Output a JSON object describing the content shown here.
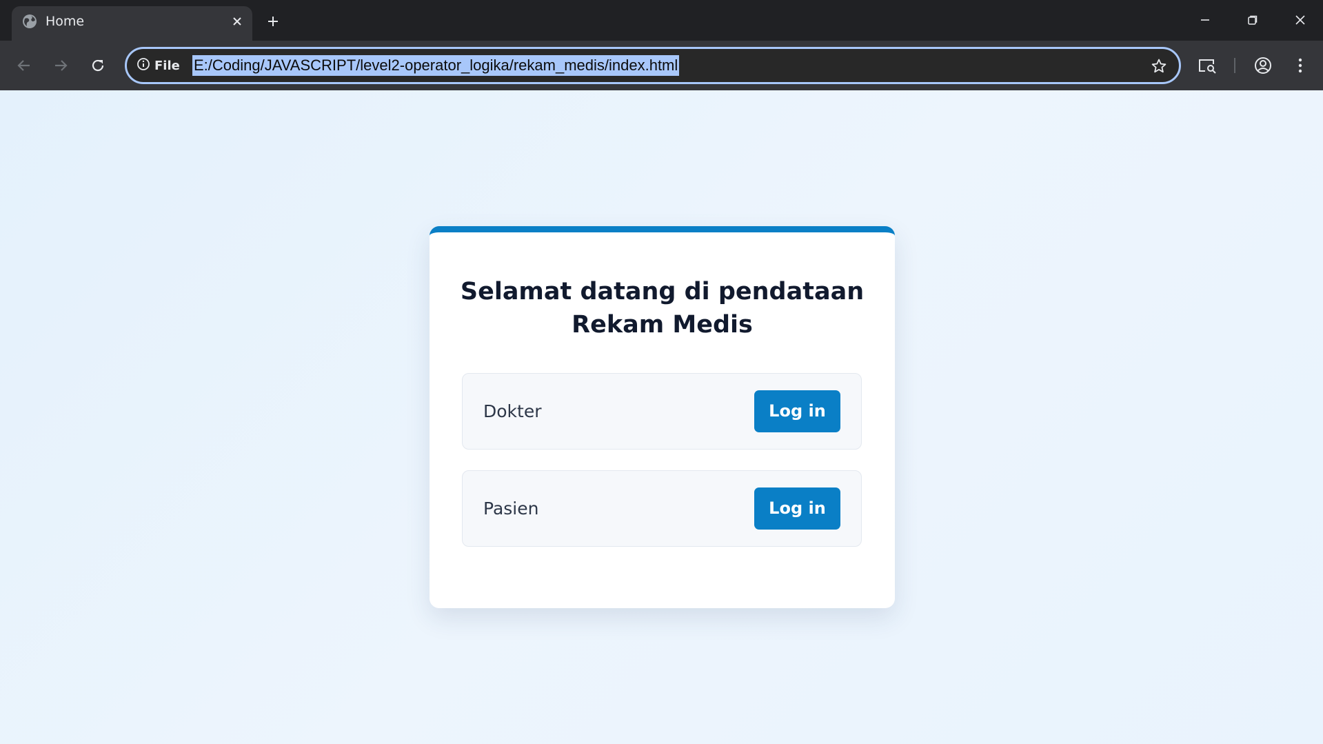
{
  "browser": {
    "tab": {
      "title": "Home",
      "favicon": "globe-icon"
    },
    "site_info_label": "File",
    "url": "E:/Coding/JAVASCRIPT/level2-operator_logika/rekam_medis/index.html",
    "colors": {
      "frame": "#202124",
      "toolbar": "#35363a",
      "omnibox_border": "#a8c7fa",
      "url_highlight": "#a8c7fa"
    }
  },
  "page": {
    "title": "Selamat datang di pendataan Rekam Medis",
    "roles": [
      {
        "label": "Dokter",
        "button": "Log in"
      },
      {
        "label": "Pasien",
        "button": "Log in"
      }
    ],
    "colors": {
      "accent": "#0a7fc6",
      "heading": "#111a2e",
      "background": "#e4f1fc"
    }
  }
}
